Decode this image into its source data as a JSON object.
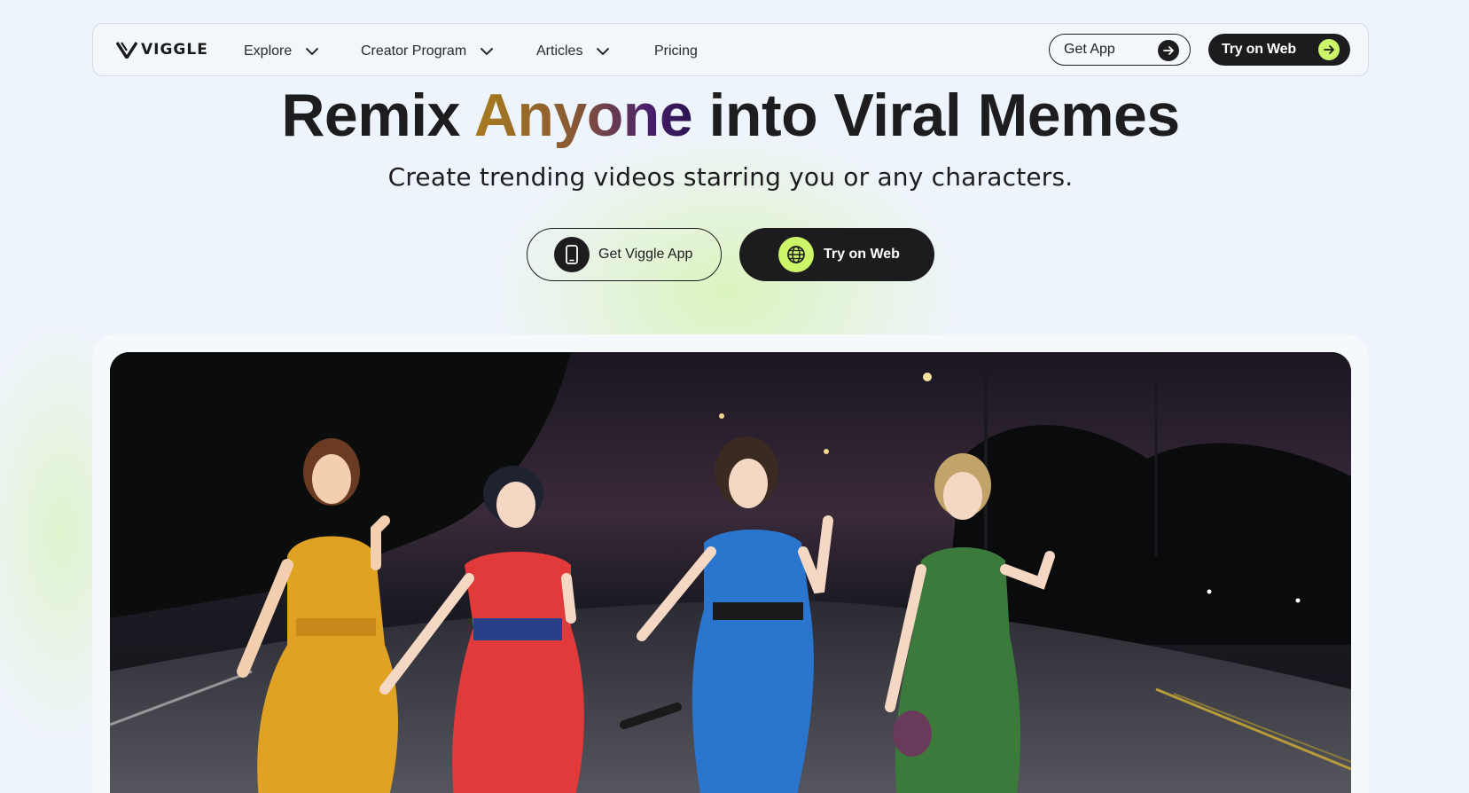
{
  "brand": {
    "name": "VIGGLE",
    "logo_icon": "viggle-v-logo"
  },
  "nav": {
    "items": [
      {
        "label": "Explore",
        "has_dropdown": true
      },
      {
        "label": "Creator Program",
        "has_dropdown": true
      },
      {
        "label": "Articles",
        "has_dropdown": true
      },
      {
        "label": "Pricing",
        "has_dropdown": false
      }
    ],
    "get_app_label": "Get App",
    "try_web_label": "Try on Web"
  },
  "hero": {
    "title_before": "Remix ",
    "title_accent": "Anyone",
    "title_after": " into Viral Memes",
    "subtitle": "Create trending videos starring you or any characters.",
    "cta_app_label": "Get Viggle App",
    "cta_web_label": "Try on Web"
  },
  "colors": {
    "accent_lime": "#cdf56a",
    "dark": "#1c1c1e",
    "background": "#eef4fb",
    "title_gradient": [
      "#a87c1e",
      "#4a1f6b"
    ]
  },
  "icons": {
    "nav_dropdown": "chevron-down-icon",
    "arrow": "arrow-right-icon",
    "phone": "phone-icon",
    "globe": "globe-icon"
  }
}
